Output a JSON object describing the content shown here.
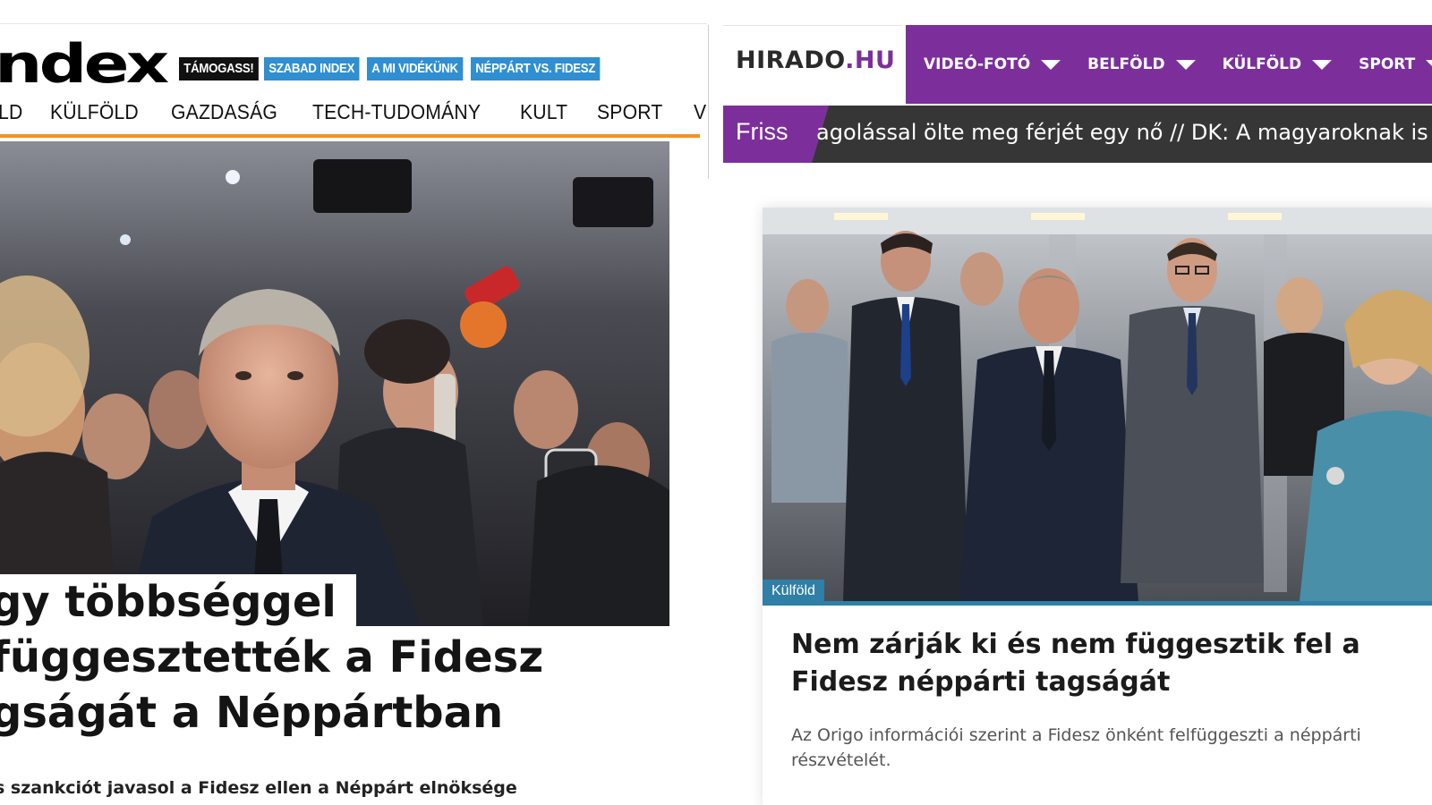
{
  "left_site": {
    "logo": "ndex",
    "tags": [
      "TÁMOGASS!",
      "SZABAD INDEX",
      "A MI VIDÉKÜNK",
      "NÉPPÁRT VS. FIDESZ"
    ],
    "nav": [
      "LD",
      "KÜLFÖLD",
      "GAZDASÁG",
      "TECH-TUDOMÁNY",
      "KULT",
      "SPORT",
      "VÉLEMÉN"
    ],
    "headline_lines": [
      "gy többséggel",
      "függesztették a Fidesz",
      "gságát a Néppártban"
    ],
    "lead": "s szankciót javasol a Fidesz ellen a Néppárt elnöksége",
    "colors": {
      "nav_underline": "#f39323",
      "tag_blue": "#2f8fd0",
      "tag_dark": "#111111"
    }
  },
  "right_site": {
    "brand_main": "HIRADO",
    "brand_tld": ".HU",
    "menu": [
      "VIDEÓ-FOTÓ",
      "BELFÖLD",
      "KÜLFÖLD",
      "SPORT"
    ],
    "ticker_label": "Friss",
    "ticker_text": "agolással ölte meg férjét egy nő // DK: A magyaroknak is",
    "article": {
      "category": "Külföld",
      "title": "Nem zárják ki és nem függesztik fel a Fidesz néppárti tagságát",
      "summary": "Az Origo információi szerint a Fidesz önként felfüggeszti a néppárti részvételét."
    },
    "colors": {
      "brand_purple": "#7c2f9b",
      "ticker_bg": "#363636",
      "category_blue": "#2f7fa6"
    }
  }
}
